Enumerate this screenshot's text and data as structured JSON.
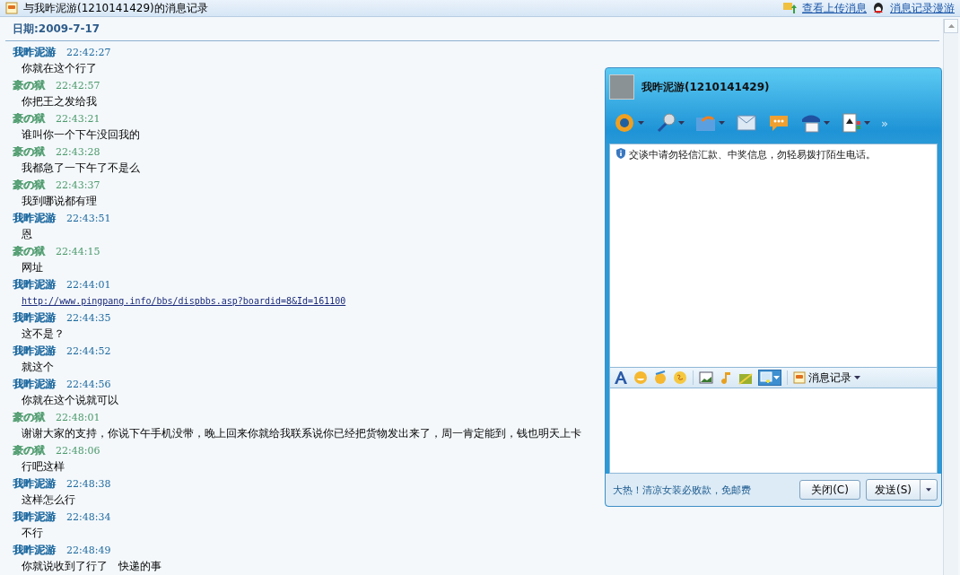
{
  "window": {
    "title": "与我昨泥游(1210141429)的消息记录"
  },
  "header_links": [
    "查看上传消息",
    "消息记录漫游"
  ],
  "date": {
    "label": "日期:",
    "value": "2009-7-17"
  },
  "messages": [
    {
      "sender": "我昨泥游",
      "color": "#1f6aa0",
      "time": "22:42:27",
      "kind": "text",
      "text": "你就在这个行了"
    },
    {
      "sender": "豪の狱",
      "color": "#4c9a6c",
      "time": "22:42:57",
      "kind": "text",
      "text": "你把王之发给我"
    },
    {
      "sender": "豪の狱",
      "color": "#4c9a6c",
      "time": "22:43:21",
      "kind": "text",
      "text": "谁叫你一个下午没回我的"
    },
    {
      "sender": "豪の狱",
      "color": "#4c9a6c",
      "time": "22:43:28",
      "kind": "text",
      "text": "我都急了一下午了不是么"
    },
    {
      "sender": "豪の狱",
      "color": "#4c9a6c",
      "time": "22:43:37",
      "kind": "text",
      "text": "我到哪说都有理"
    },
    {
      "sender": "我昨泥游",
      "color": "#1f6aa0",
      "time": "22:43:51",
      "kind": "text",
      "text": "恩"
    },
    {
      "sender": "豪の狱",
      "color": "#4c9a6c",
      "time": "22:44:15",
      "kind": "text",
      "text": "网址"
    },
    {
      "sender": "我昨泥游",
      "color": "#1f6aa0",
      "time": "22:44:01",
      "kind": "link",
      "text": "http://www.pingpang.info/bbs/dispbbs.asp?boardid=8&Id=161100"
    },
    {
      "sender": "我昨泥游",
      "color": "#1f6aa0",
      "time": "22:44:35",
      "kind": "text",
      "text": "这不是？"
    },
    {
      "sender": "我昨泥游",
      "color": "#1f6aa0",
      "time": "22:44:52",
      "kind": "text",
      "text": "就这个"
    },
    {
      "sender": "我昨泥游",
      "color": "#1f6aa0",
      "time": "22:44:56",
      "kind": "text",
      "text": "你就在这个说就可以"
    },
    {
      "sender": "豪の狱",
      "color": "#4c9a6c",
      "time": "22:48:01",
      "kind": "text",
      "text": "谢谢大家的支持，你说下午手机没带，晚上回来你就给我联系说你已经把货物发出来了，周一肯定能到，钱也明天上卡"
    },
    {
      "sender": "豪の狱",
      "color": "#4c9a6c",
      "time": "22:48:06",
      "kind": "text",
      "text": "行吧这样"
    },
    {
      "sender": "我昨泥游",
      "color": "#1f6aa0",
      "time": "22:48:38",
      "kind": "text",
      "text": "这样怎么行"
    },
    {
      "sender": "我昨泥游",
      "color": "#1f6aa0",
      "time": "22:48:34",
      "kind": "text",
      "text": "不行"
    },
    {
      "sender": "我昨泥游",
      "color": "#1f6aa0",
      "time": "22:48:49",
      "kind": "text",
      "text": "你就说收到了行了　快递的事"
    }
  ],
  "chat_window": {
    "contact": "我昨泥游(1210141429)",
    "more": "»",
    "notice": "交谈中请勿轻信汇款、中奖信息，勿轻易拨打陌生电话。",
    "history_button": "消息记录",
    "ad": "大热！清凉女装必败款，免邮费",
    "close_button": "关闭(C)",
    "send_button": "发送(S)"
  }
}
